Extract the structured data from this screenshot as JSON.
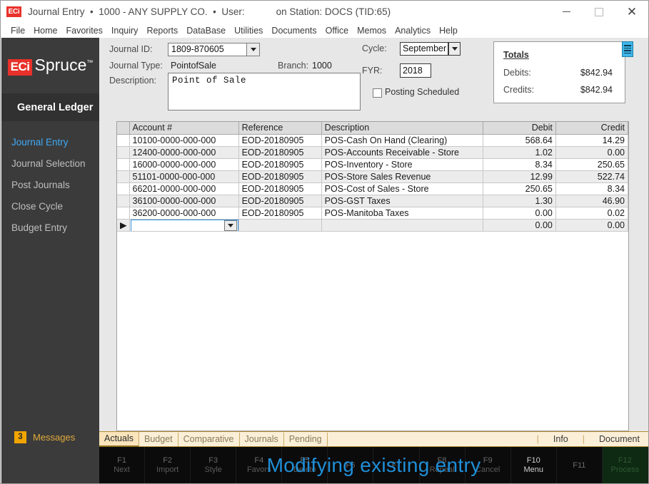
{
  "window": {
    "app_badge": "ECi",
    "title": "Journal Entry  •  1000 - ANY SUPPLY CO.  •  User:",
    "station": "on Station: DOCS (TID:65)",
    "minimize": "—",
    "maximize": "□",
    "close": "✕"
  },
  "menubar": {
    "items": [
      "File",
      "Home",
      "Favorites",
      "Inquiry",
      "Reports",
      "DataBase",
      "Utilities",
      "Documents",
      "Office",
      "Memos",
      "Analytics",
      "Help"
    ]
  },
  "sidebar": {
    "logo_mark": "ECi",
    "logo_text": "Spruce",
    "module_title": "General Ledger",
    "items": [
      {
        "label": "Journal Entry",
        "active": true
      },
      {
        "label": "Journal Selection",
        "active": false
      },
      {
        "label": "Post Journals",
        "active": false
      },
      {
        "label": "Close Cycle",
        "active": false
      },
      {
        "label": "Budget Entry",
        "active": false
      }
    ],
    "messages": {
      "count": "3",
      "label": "Messages"
    }
  },
  "form": {
    "journal_id_label": "Journal ID:",
    "journal_id_value": "1809-870605",
    "journal_type_label": "Journal Type:",
    "journal_type_value": "PointofSale",
    "branch_label": "Branch:",
    "branch_value": "1000",
    "description_label": "Description:",
    "description_value": "Point of Sale",
    "cycle_label": "Cycle:",
    "cycle_value": "September",
    "fyr_label": "FYR:",
    "fyr_value": "2018",
    "posting_scheduled_label": "Posting Scheduled",
    "posting_scheduled_checked": false
  },
  "totals": {
    "title": "Totals",
    "debits_label": "Debits:",
    "debits_value": "$842.94",
    "credits_label": "Credits:",
    "credits_value": "$842.94",
    "notes_icon": "notes-icon"
  },
  "grid": {
    "columns": [
      "Account #",
      "Reference",
      "Description",
      "Debit",
      "Credit"
    ],
    "rows": [
      {
        "account": "10100-0000-000-000",
        "reference": "EOD-20180905",
        "description": "POS-Cash On Hand (Clearing)",
        "debit": "568.64",
        "credit": "14.29"
      },
      {
        "account": "12400-0000-000-000",
        "reference": "EOD-20180905",
        "description": "POS-Accounts Receivable - Store",
        "debit": "1.02",
        "credit": "0.00"
      },
      {
        "account": "16000-0000-000-000",
        "reference": "EOD-20180905",
        "description": "POS-Inventory - Store",
        "debit": "8.34",
        "credit": "250.65"
      },
      {
        "account": "51101-0000-000-000",
        "reference": "EOD-20180905",
        "description": "POS-Store Sales Revenue",
        "debit": "12.99",
        "credit": "522.74"
      },
      {
        "account": "66201-0000-000-000",
        "reference": "EOD-20180905",
        "description": "POS-Cost of Sales - Store",
        "debit": "250.65",
        "credit": "8.34"
      },
      {
        "account": "36100-0000-000-000",
        "reference": "EOD-20180905",
        "description": "POS-GST Taxes",
        "debit": "1.30",
        "credit": "46.90"
      },
      {
        "account": "36200-0000-000-000",
        "reference": "EOD-20180905",
        "description": "POS-Manitoba Taxes",
        "debit": "0.00",
        "credit": "0.02"
      }
    ],
    "new_row": {
      "marker": "▶",
      "account": "",
      "reference": "",
      "description": "",
      "debit": "0.00",
      "credit": "0.00"
    }
  },
  "tabs": {
    "items": [
      {
        "label": "Actuals",
        "active": true
      },
      {
        "label": "Budget",
        "active": false
      },
      {
        "label": "Comparative",
        "active": false
      },
      {
        "label": "Journals",
        "active": false
      },
      {
        "label": "Pending",
        "active": false
      }
    ],
    "right_actions": [
      "Info",
      "Document"
    ]
  },
  "fkeys": [
    {
      "key": "F1",
      "name": "Next",
      "strong": false
    },
    {
      "key": "F2",
      "name": "Import",
      "strong": false
    },
    {
      "key": "F3",
      "name": "Style",
      "strong": false
    },
    {
      "key": "F4",
      "name": "Favors",
      "strong": false
    },
    {
      "key": "F5",
      "name": "Delete",
      "strong": false
    },
    {
      "key": "F6",
      "name": "",
      "strong": false
    },
    {
      "key": "F7",
      "name": "",
      "strong": false
    },
    {
      "key": "F8",
      "name": "Repeal",
      "strong": false
    },
    {
      "key": "F9",
      "name": "Cancel",
      "strong": false
    },
    {
      "key": "F10",
      "name": "Menu",
      "strong": true
    },
    {
      "key": "F11",
      "name": "",
      "strong": false
    },
    {
      "key": "F12",
      "name": "Process",
      "strong": false
    }
  ],
  "status_message": "Modifying existing entry",
  "colors": {
    "brand_red": "#e8312a",
    "sidebar_bg": "#3b3b3b",
    "active_nav": "#3fa9f5",
    "tab_bg": "#fbefd8",
    "status_blue": "#1f8fd8",
    "accent_amber": "#f0a500"
  }
}
